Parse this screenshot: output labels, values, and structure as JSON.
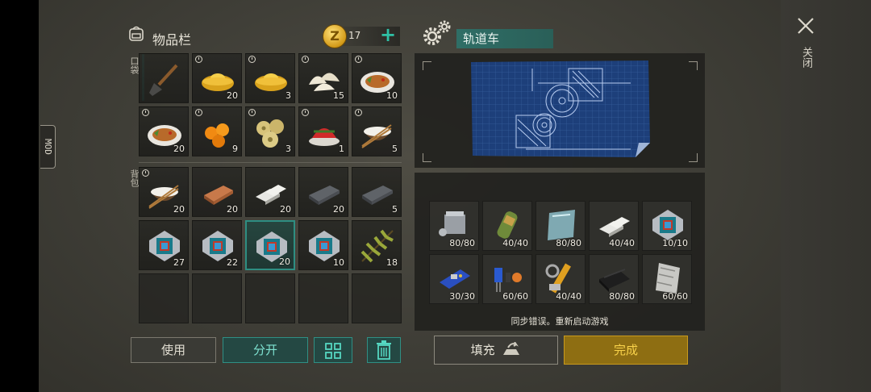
{
  "side_tab": {
    "label": "MOD"
  },
  "inventory": {
    "title": "物品栏",
    "coins": {
      "icon": "coin-icon",
      "symbol": "Z",
      "count": "17",
      "add": "+"
    },
    "pockets_label": "口袋",
    "backpack_label": "背包",
    "pockets": [
      {
        "icon": "shovel-icon",
        "count": ""
      },
      {
        "icon": "gold-ingot-icon",
        "count": "20",
        "timer": true
      },
      {
        "icon": "gold-ingot-icon",
        "count": "3",
        "timer": true
      },
      {
        "icon": "dumplings-icon",
        "count": "15",
        "timer": true
      },
      {
        "icon": "fish-dish-icon",
        "count": "10",
        "timer": true
      },
      {
        "icon": "fish-dish-icon",
        "count": "20",
        "timer": true
      },
      {
        "icon": "kumquat-icon",
        "count": "9",
        "timer": true
      },
      {
        "icon": "lotus-root-icon",
        "count": "3",
        "timer": true
      },
      {
        "icon": "red-dessert-icon",
        "count": "1",
        "timer": true
      },
      {
        "icon": "rice-bowl-icon",
        "count": "5",
        "timer": true
      }
    ],
    "backpack": [
      {
        "icon": "rice-bowl-icon",
        "count": "20",
        "timer": true
      },
      {
        "icon": "copper-bar-icon",
        "count": "20"
      },
      {
        "icon": "aluminum-bars-icon",
        "count": "20"
      },
      {
        "icon": "steel-bar-icon",
        "count": "20"
      },
      {
        "icon": "steel-bar-icon",
        "count": "5"
      },
      {
        "icon": "microchip-icon",
        "count": "27"
      },
      {
        "icon": "microchip-icon",
        "count": "22"
      },
      {
        "icon": "microchip-icon",
        "count": "20",
        "selected": true
      },
      {
        "icon": "microchip-icon",
        "count": "10"
      },
      {
        "icon": "pine-branch-icon",
        "count": "18"
      },
      {
        "icon": "",
        "count": ""
      },
      {
        "icon": "",
        "count": ""
      },
      {
        "icon": "",
        "count": ""
      },
      {
        "icon": "",
        "count": ""
      },
      {
        "icon": "",
        "count": ""
      }
    ],
    "buttons": {
      "use": "使用",
      "split": "分开",
      "sort_icon": "grid-icon",
      "trash_icon": "trash-icon"
    }
  },
  "crafting": {
    "icon": "gears-icon",
    "name": "轨道车",
    "blueprint_icon": "blueprint-icon",
    "requirements": [
      {
        "icon": "engine-icon",
        "count": "80/80"
      },
      {
        "icon": "fuel-cell-icon",
        "count": "40/40"
      },
      {
        "icon": "glass-sheet-icon",
        "count": "80/80"
      },
      {
        "icon": "aluminum-bar-icon",
        "count": "40/40"
      },
      {
        "icon": "microchip-icon",
        "count": "10/10"
      },
      {
        "icon": "circuit-board-icon",
        "count": "30/30"
      },
      {
        "icon": "capacitors-icon",
        "count": "60/60"
      },
      {
        "icon": "hydraulic-parts-icon",
        "count": "40/40"
      },
      {
        "icon": "rubber-icon",
        "count": "80/80"
      },
      {
        "icon": "metal-foil-icon",
        "count": "60/60"
      }
    ],
    "error_message": "同步错误。重新启动游戏",
    "fill_label": "填充",
    "done_label": "完成"
  },
  "close": {
    "icon": "close-icon",
    "label": "关闭"
  },
  "colors": {
    "accent": "#2fc1a6",
    "done": "#f8d24a",
    "done_bg": "#8e6e12"
  }
}
